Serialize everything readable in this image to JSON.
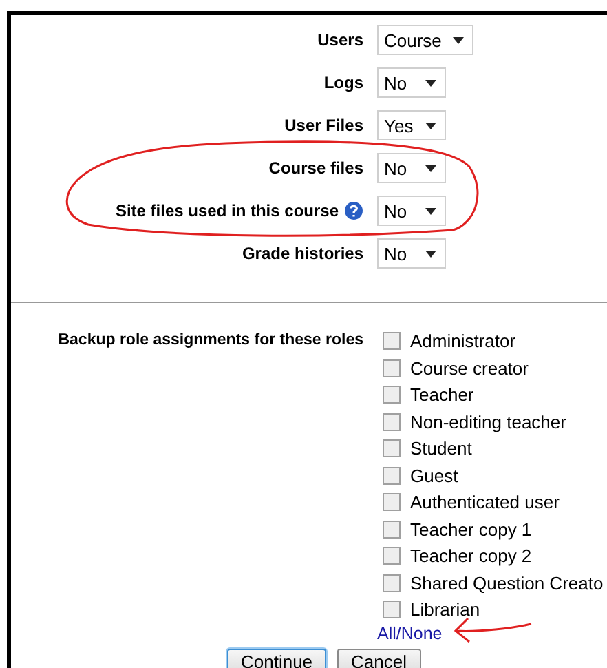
{
  "fields": [
    {
      "label": "Users",
      "value": "Course",
      "has_help": false
    },
    {
      "label": "Logs",
      "value": "No",
      "has_help": false
    },
    {
      "label": "User Files",
      "value": "Yes",
      "has_help": false
    },
    {
      "label": "Course files",
      "value": "No",
      "has_help": false
    },
    {
      "label": "Site files used in this course",
      "value": "No",
      "has_help": true
    },
    {
      "label": "Grade histories",
      "value": "No",
      "has_help": false
    }
  ],
  "roles": {
    "label": "Backup role assignments for these roles",
    "items": [
      {
        "label": "Administrator",
        "checked": false
      },
      {
        "label": "Course creator",
        "checked": false
      },
      {
        "label": "Teacher",
        "checked": false
      },
      {
        "label": "Non-editing teacher",
        "checked": false
      },
      {
        "label": "Student",
        "checked": false
      },
      {
        "label": "Guest",
        "checked": false
      },
      {
        "label": "Authenticated user",
        "checked": false
      },
      {
        "label": "Teacher copy 1",
        "checked": false
      },
      {
        "label": "Teacher copy 2",
        "checked": false
      },
      {
        "label": "Shared Question Creato",
        "checked": false
      },
      {
        "label": "Librarian",
        "checked": false
      }
    ],
    "link": "All/None"
  },
  "buttons": [
    {
      "label": "Continue",
      "focused": true
    },
    {
      "label": "Cancel",
      "focused": false
    }
  ]
}
